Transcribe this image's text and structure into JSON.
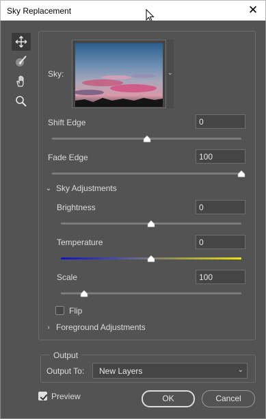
{
  "window": {
    "title": "Sky Replacement",
    "close_glyph": "✕"
  },
  "toolbar": {
    "tools": [
      {
        "name": "move-sky-tool",
        "icon": "move-arrows-icon",
        "active": true
      },
      {
        "name": "sky-brush-tool",
        "icon": "brush-icon",
        "active": false
      },
      {
        "name": "hand-tool",
        "icon": "hand-icon",
        "active": false
      },
      {
        "name": "zoom-tool",
        "icon": "zoom-icon",
        "active": false
      }
    ]
  },
  "sky": {
    "label": "Sky:",
    "dropdown_glyph": "⌄"
  },
  "shift_edge": {
    "label": "Shift Edge",
    "value": "0",
    "slider_fraction": 0.5
  },
  "fade_edge": {
    "label": "Fade Edge",
    "value": "100",
    "slider_fraction": 1.0
  },
  "sky_adjustments": {
    "label": "Sky Adjustments",
    "expanded": true,
    "expanded_glyph": "⌄",
    "brightness": {
      "label": "Brightness",
      "value": "0",
      "slider_fraction": 0.5
    },
    "temperature": {
      "label": "Temperature",
      "value": "0",
      "slider_fraction": 0.5
    },
    "scale": {
      "label": "Scale",
      "value": "100",
      "slider_fraction": 0.13
    },
    "flip": {
      "label": "Flip",
      "checked": false
    }
  },
  "foreground_adjustments": {
    "label": "Foreground Adjustments",
    "expanded": false,
    "collapsed_glyph": "›"
  },
  "output": {
    "group_label": "Output",
    "output_to_label": "Output To:",
    "output_to_value": "New Layers",
    "caret_glyph": "⌄"
  },
  "preview": {
    "label": "Preview",
    "checked": true
  },
  "buttons": {
    "ok": "OK",
    "cancel": "Cancel"
  },
  "colors": {
    "dialog_bg": "#535353",
    "field_bg": "#454545",
    "text": "#dcdcdc",
    "temp_cool": "#1412c4",
    "temp_warm": "#e9e311"
  }
}
